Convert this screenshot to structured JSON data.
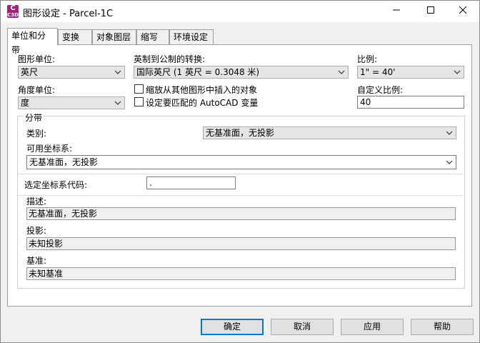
{
  "window": {
    "title": "图形设定 - Parcel-1C",
    "app_icon_text": "C",
    "app_icon_sub": "C3D"
  },
  "tabs": [
    {
      "label": "单位和分带",
      "active": true
    },
    {
      "label": "变换",
      "active": false
    },
    {
      "label": "对象图层",
      "active": false
    },
    {
      "label": "缩写",
      "active": false
    },
    {
      "label": "环境设定",
      "active": false
    }
  ],
  "units": {
    "drawing_unit_label": "图形单位:",
    "drawing_unit_value": "英尺",
    "imperial_label": "英制到公制的转换:",
    "imperial_value": "国际英尺 (1 英尺 = 0.3048 米)",
    "scale_label": "比例:",
    "scale_value": "1\" = 40'",
    "angle_unit_label": "角度单位:",
    "angle_unit_value": "度",
    "scale_objects_label": "缩放从其他图形中插入的对象",
    "set_autocad_label": "设定要匹配的 AutoCAD 变量",
    "custom_scale_label": "自定义比例:",
    "custom_scale_value": "40"
  },
  "zone": {
    "group_label": "分带",
    "category_label": "类别:",
    "category_value": "无基准面，无投影",
    "available_cs_label": "可用坐标系:",
    "available_cs_value": "无基准面，无投影",
    "selected_code_label": "选定坐标系代码:",
    "selected_code_value": ".",
    "description_label": "描述:",
    "description_value": "无基准面，无投影",
    "projection_label": "投影:",
    "projection_value": "未知投影",
    "datum_label": "基准:",
    "datum_value": "未知基准"
  },
  "buttons": {
    "ok": "确定",
    "cancel": "取消",
    "apply": "应用",
    "help": "帮助"
  },
  "colors": {
    "app_icon": "#a3217b",
    "default_button_border": "#0078d7"
  }
}
